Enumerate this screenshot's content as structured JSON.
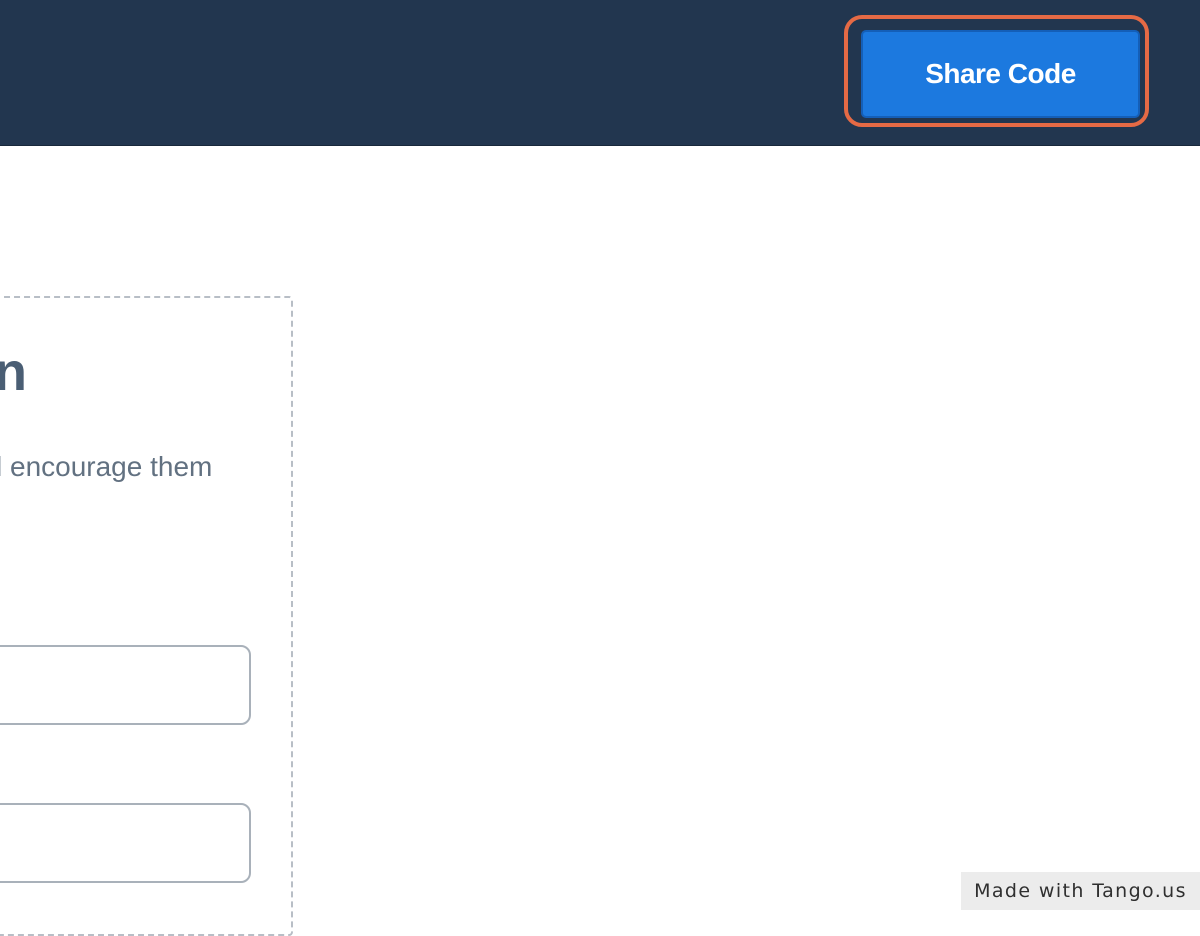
{
  "header": {
    "share_code_label": "Share Code",
    "highlight_color": "#e56a45",
    "button_color": "#1c79df",
    "background_color": "#22364f"
  },
  "card": {
    "title_visible_fragment": "n",
    "description_visible_fragment": "l encourage them",
    "fields": [
      {
        "value": "",
        "placeholder": ""
      },
      {
        "value": "",
        "placeholder": ""
      }
    ]
  },
  "watermark": {
    "text": "Made with Tango.us"
  }
}
